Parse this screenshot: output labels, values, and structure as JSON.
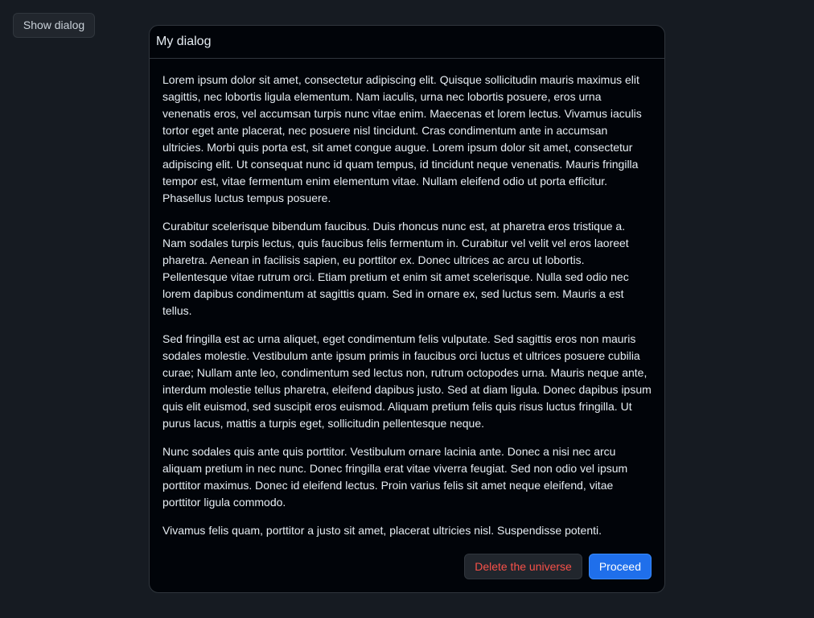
{
  "page": {
    "show_dialog_label": "Show dialog"
  },
  "dialog": {
    "title": "My dialog",
    "paragraphs": [
      "Lorem ipsum dolor sit amet, consectetur adipiscing elit. Quisque sollicitudin mauris maximus elit sagittis, nec lobortis ligula elementum. Nam iaculis, urna nec lobortis posuere, eros urna venenatis eros, vel accumsan turpis nunc vitae enim. Maecenas et lorem lectus. Vivamus iaculis tortor eget ante placerat, nec posuere nisl tincidunt. Cras condimentum ante in accumsan ultricies. Morbi quis porta est, sit amet congue augue. Lorem ipsum dolor sit amet, consectetur adipiscing elit. Ut consequat nunc id quam tempus, id tincidunt neque venenatis. Mauris fringilla tempor est, vitae fermentum enim elementum vitae. Nullam eleifend odio ut porta efficitur. Phasellus luctus tempus posuere.",
      "Curabitur scelerisque bibendum faucibus. Duis rhoncus nunc est, at pharetra eros tristique a. Nam sodales turpis lectus, quis faucibus felis fermentum in. Curabitur vel velit vel eros laoreet pharetra. Aenean in facilisis sapien, eu porttitor ex. Donec ultrices ac arcu ut lobortis. Pellentesque vitae rutrum orci. Etiam pretium et enim sit amet scelerisque. Nulla sed odio nec lorem dapibus condimentum at sagittis quam. Sed in ornare ex, sed luctus sem. Mauris a est tellus.",
      "Sed fringilla est ac urna aliquet, eget condimentum felis vulputate. Sed sagittis eros non mauris sodales molestie. Vestibulum ante ipsum primis in faucibus orci luctus et ultrices posuere cubilia curae; Nullam ante leo, condimentum sed lectus non, rutrum octopodes urna. Mauris neque ante, interdum molestie tellus pharetra, eleifend dapibus justo. Sed at diam ligula. Donec dapibus ipsum quis elit euismod, sed suscipit eros euismod. Aliquam pretium felis quis risus luctus fringilla. Ut purus lacus, mattis a turpis eget, sollicitudin pellentesque neque.",
      "Nunc sodales quis ante quis porttitor. Vestibulum ornare lacinia ante. Donec a nisi nec arcu aliquam pretium in nec nunc. Donec fringilla erat vitae viverra feugiat. Sed non odio vel ipsum porttitor maximus. Donec id eleifend lectus. Proin varius felis sit amet neque eleifend, vitae porttitor ligula commodo.",
      "Vivamus felis quam, porttitor a justo sit amet, placerat ultricies nisl. Suspendisse potenti."
    ],
    "footer": {
      "danger_label": "Delete the universe",
      "primary_label": "Proceed"
    }
  },
  "colors": {
    "page_background": "#161b22",
    "dialog_background": "#010409",
    "border": "#30363d",
    "text": "#e6edf3",
    "danger_text": "#f85149",
    "primary_button": "#1f6feb"
  }
}
